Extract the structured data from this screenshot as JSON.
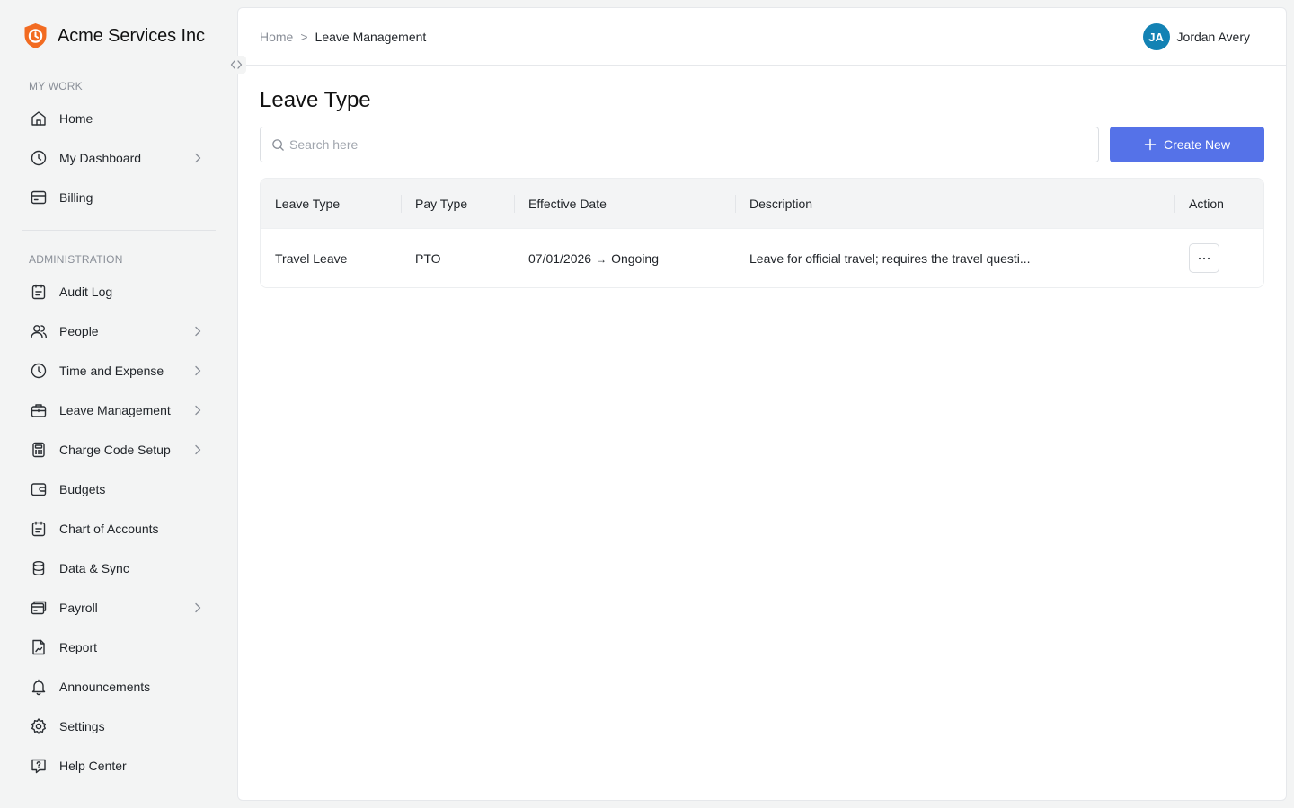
{
  "brand": {
    "name": "Acme Services Inc",
    "logo_icon": "shield-clock-icon",
    "accent": "#f26b21"
  },
  "sidebar": {
    "sections": [
      {
        "label": "MY WORK",
        "items": [
          {
            "label": "Home",
            "icon": "home-icon",
            "has_submenu": false
          },
          {
            "label": "My Dashboard",
            "icon": "clock-icon",
            "has_submenu": true
          },
          {
            "label": "Billing",
            "icon": "billing-icon",
            "has_submenu": false
          }
        ]
      },
      {
        "label": "ADMINISTRATION",
        "items": [
          {
            "label": "Audit Log",
            "icon": "clipboard-icon",
            "has_submenu": false
          },
          {
            "label": "People",
            "icon": "users-icon",
            "has_submenu": true
          },
          {
            "label": "Time and Expense",
            "icon": "clock-icon",
            "has_submenu": true
          },
          {
            "label": "Leave Management",
            "icon": "briefcase-icon",
            "has_submenu": true
          },
          {
            "label": "Charge Code Setup",
            "icon": "calculator-icon",
            "has_submenu": true
          },
          {
            "label": "Budgets",
            "icon": "wallet-icon",
            "has_submenu": false
          },
          {
            "label": "Chart of Accounts",
            "icon": "clipboard-list-icon",
            "has_submenu": false
          },
          {
            "label": "Data & Sync",
            "icon": "database-icon",
            "has_submenu": false
          },
          {
            "label": "Payroll",
            "icon": "payroll-icon",
            "has_submenu": true
          },
          {
            "label": "Report",
            "icon": "report-icon",
            "has_submenu": false
          },
          {
            "label": "Announcements",
            "icon": "bell-icon",
            "has_submenu": false
          },
          {
            "label": "Settings",
            "icon": "gear-icon",
            "has_submenu": false
          },
          {
            "label": "Help Center",
            "icon": "help-icon",
            "has_submenu": false
          }
        ]
      }
    ]
  },
  "header": {
    "breadcrumb": {
      "home": "Home",
      "separator": ">",
      "current": "Leave Management"
    },
    "user": {
      "initials": "JA",
      "name": "Jordan Avery",
      "avatar_color": "#1382b4"
    }
  },
  "main": {
    "title": "Leave Type",
    "search": {
      "placeholder": "Search here",
      "value": ""
    },
    "create_button": {
      "label": "Create New",
      "color": "#5572e8"
    },
    "table": {
      "columns": [
        "Leave Type",
        "Pay Type",
        "Effective Date",
        "Description",
        "Action"
      ],
      "rows": [
        {
          "leave_type": "Travel Leave",
          "pay_type": "PTO",
          "effective_start": "07/01/2026",
          "effective_arrow": "→",
          "effective_end": "Ongoing",
          "description": "Leave for official travel; requires the travel questi..."
        }
      ]
    }
  }
}
